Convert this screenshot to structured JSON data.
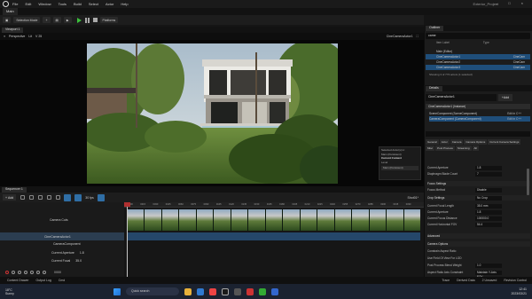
{
  "window": {
    "project_name": "Exterior_Project",
    "menu": [
      "File",
      "Edit",
      "Window",
      "Tools",
      "Build",
      "Select",
      "Actor",
      "Help"
    ],
    "main_tab": "Main"
  },
  "toolbar": {
    "selection_mode": "Selection Mode",
    "platforms": "Platforms"
  },
  "viewport": {
    "tab_label": "Viewport 1",
    "perspective_label": "Perspective",
    "lit_label": "Lit",
    "fov": "V 25",
    "camera_actor": "CineCameraActor1",
    "level_popup": {
      "line1": "Selected Actor(s) in:",
      "line2": "Main (Persistent)",
      "current_context": "Current Context",
      "level_label": "Level",
      "level_value": "Main (Persistent)"
    }
  },
  "sequencer": {
    "tab_label": "Sequencer 1",
    "add_label": "Add",
    "fps": "30 fps",
    "shot": "Shot01*",
    "tracks": [
      {
        "name": "Camera Cuts"
      },
      {
        "name": "CineCameraActor1"
      },
      {
        "name": "CameraComponent"
      },
      {
        "name": "Current Aperture",
        "value": "1.8"
      },
      {
        "name": "Current Focal",
        "value": "35.0"
      }
    ],
    "time_markers": [
      "0000",
      "0015",
      "0030",
      "0045",
      "0060",
      "0075",
      "0090",
      "0105",
      "0120",
      "0135",
      "0150",
      "0165",
      "0180",
      "0195",
      "0210",
      "0225",
      "0240",
      "0255",
      "0270",
      "0285",
      "0300",
      "0315",
      "0330"
    ],
    "transport_frame": "0000"
  },
  "bottom_tabs": [
    "Content Drawer",
    "Output Log",
    "Cmd"
  ],
  "outliner": {
    "tab_label": "Outliner",
    "search_value": "came",
    "columns": [
      "Item Label",
      "Type"
    ],
    "rows": [
      {
        "label": "Main (Editor)",
        "type": "",
        "selected": false
      },
      {
        "label": "CineCameraActor1",
        "type": "CineCam",
        "selected": true
      },
      {
        "label": "CineCameraActor2",
        "type": "CineCam",
        "selected": false
      },
      {
        "label": "CineCameraActor3",
        "type": "CineCam",
        "selected": true
      }
    ],
    "showing": "Showing 3 of 773 actors (1 selected)"
  },
  "details": {
    "tab_label": "Details",
    "actor_name": "CineCameraActor1",
    "add_label": "Add",
    "instance": "CineCameraActor1 (Instance)",
    "components": [
      {
        "label": "SceneComponent (SceneComponent)",
        "value": "Edit in C++",
        "selected": false
      },
      {
        "label": "CameraComponent (CameraComponent)",
        "value": "Edit in C++",
        "selected": true
      }
    ],
    "filter_tabs": [
      "General",
      "Actor",
      "Camera",
      "Camera Options",
      "Current Camera Settings",
      "Misc",
      "Post Process",
      "Streaming",
      "All"
    ],
    "props": [
      {
        "label": "Current Aperture",
        "value": "1.8",
        "section": false
      },
      {
        "label": "Diaphragm Blade Count",
        "value": "7",
        "section": false
      },
      {
        "label": "Focus Settings",
        "value": "",
        "section": true
      },
      {
        "label": "Focus Method",
        "value": "Disable",
        "section": false
      },
      {
        "label": "Crop Settings",
        "value": "No Crop",
        "section": true
      },
      {
        "label": "Current Focal Length",
        "value": "35.0 mm",
        "section": false
      },
      {
        "label": "Current Aperture",
        "value": "1.8",
        "section": false
      },
      {
        "label": "Current Focus Distance",
        "value": "100000.0",
        "section": false
      },
      {
        "label": "Current Horizontal FOV",
        "value": "54.4",
        "section": false
      },
      {
        "label": "Advanced",
        "value": "",
        "section": true
      },
      {
        "label": "Camera Options",
        "value": "",
        "section": true
      },
      {
        "label": "Constrain Aspect Ratio",
        "value": "",
        "section": false
      },
      {
        "label": "Use Field Of View For LOD",
        "value": "",
        "section": false
      },
      {
        "label": "Post Process Blend Weight",
        "value": "1.0",
        "section": false
      },
      {
        "label": "Aspect Ratio Axis Constraint",
        "value": "Maintain Y-Axis FOV",
        "section": false
      }
    ]
  },
  "statusbar": {
    "trace": "Trace",
    "derived": "Derived Data",
    "unsaved": "2 Unsaved",
    "revision": "Revision Control"
  },
  "taskbar": {
    "temp": "18°C",
    "weather": "Sunny",
    "search": "Quick search",
    "time": "12:41",
    "date": "2023/03/21"
  }
}
